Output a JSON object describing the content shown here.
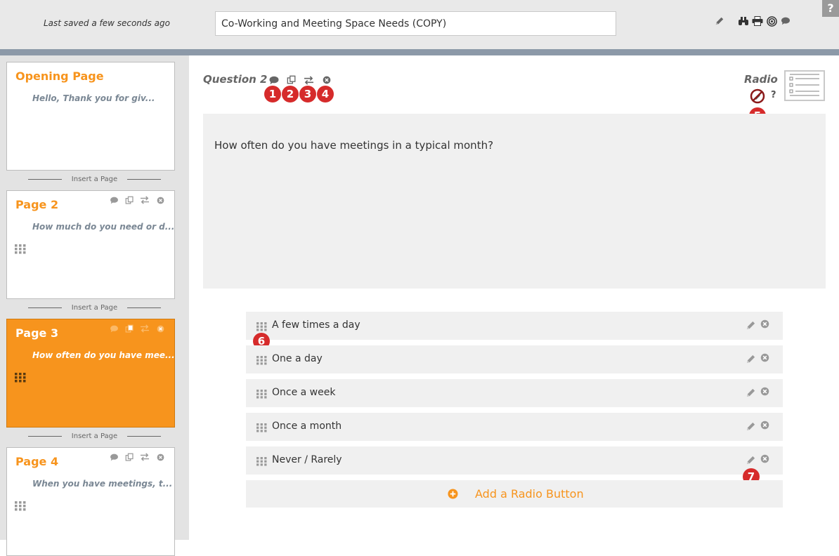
{
  "header": {
    "saved_status": "Last saved a few seconds ago",
    "survey_title": "Co-Working and Meeting Space Needs (COPY)",
    "tools": [
      "pencil-icon",
      "binoculars-icon",
      "printer-icon",
      "target-icon",
      "comment-icon"
    ],
    "help_label": "?"
  },
  "sidebar": {
    "insert_label": "Insert a Page",
    "pages": [
      {
        "title": "Opening Page",
        "subtitle": "Hello, Thank you for giv...",
        "active": false
      },
      {
        "title": "Page 2",
        "subtitle": "How much do you need or d...",
        "active": false
      },
      {
        "title": "Page 3",
        "subtitle": "How often do you have mee...",
        "active": true
      },
      {
        "title": "Page 4",
        "subtitle": "When you have meetings, t...",
        "active": false
      }
    ]
  },
  "question": {
    "label": "Question 2",
    "type": "Radio",
    "type_help": "?",
    "text": "How often do you have meetings in a typical month?",
    "badges": [
      "1",
      "2",
      "3",
      "4",
      "5",
      "6",
      "7"
    ],
    "options": [
      "A few times a day",
      "One a day",
      "Once a week",
      "Once a month",
      "Never / Rarely"
    ],
    "add_button": "Add a Radio Button"
  },
  "colors": {
    "accent": "#f7941d",
    "badge": "#d62b2b",
    "divider": "#8c99a8",
    "sidebar_bg": "#e3e3e3"
  }
}
